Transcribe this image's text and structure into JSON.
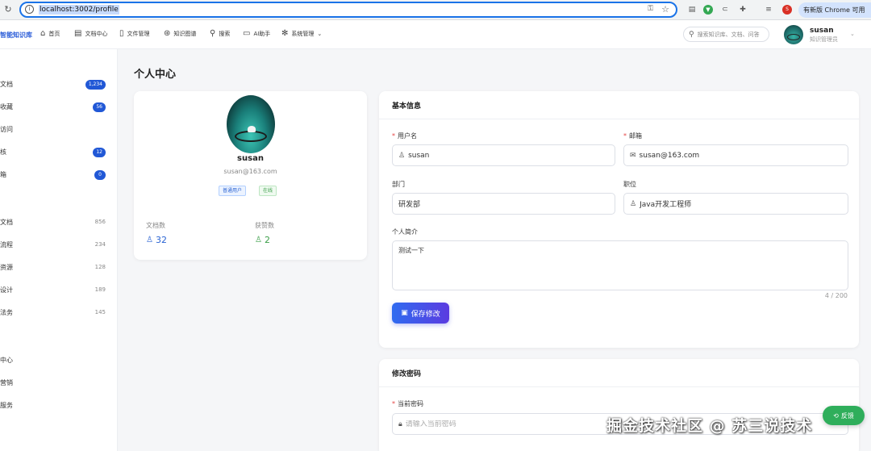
{
  "browser": {
    "url": "localhost:3002/profile",
    "update_label": "有新版 Chrome 可用"
  },
  "header": {
    "brand": "智能知识库",
    "nav": [
      {
        "label": "首页",
        "icon": "home-icon"
      },
      {
        "label": "文档中心",
        "icon": "document-icon"
      },
      {
        "label": "文件管理",
        "icon": "file-icon"
      },
      {
        "label": "知识图谱",
        "icon": "graph-icon"
      },
      {
        "label": "搜索",
        "icon": "search-icon"
      },
      {
        "label": "AI助手",
        "icon": "chat-icon"
      },
      {
        "label": "系统管理",
        "icon": "settings-icon"
      }
    ],
    "search_placeholder": "搜索知识库、文档、问答",
    "user": {
      "name": "susan",
      "role": "知识管理员"
    }
  },
  "sidebar": {
    "items": [
      {
        "label": "文档",
        "badge": "1,234"
      },
      {
        "label": "收藏",
        "badge": "56"
      },
      {
        "label": "访问",
        "badge": ""
      },
      {
        "label": "核",
        "badge": "12"
      },
      {
        "label": "箱",
        "badge": "0"
      }
    ],
    "categories": [
      {
        "label": "文档",
        "count": "856"
      },
      {
        "label": "流程",
        "count": "234"
      },
      {
        "label": "资源",
        "count": "128"
      },
      {
        "label": "设计",
        "count": "189"
      },
      {
        "label": "法务",
        "count": "145"
      }
    ],
    "extra": [
      {
        "label": "中心"
      },
      {
        "label": "营销"
      },
      {
        "label": "服务"
      }
    ]
  },
  "page": {
    "title": "个人中心"
  },
  "profile": {
    "name": "susan",
    "email": "susan@163.com",
    "tags": [
      "普通用户",
      "在线"
    ],
    "stats": [
      {
        "label": "文档数",
        "value": "32"
      },
      {
        "label": "获赞数",
        "value": "2"
      }
    ]
  },
  "basic_info": {
    "title": "基本信息",
    "username": {
      "label": "用户名",
      "value": "susan"
    },
    "email": {
      "label": "邮箱",
      "value": "susan@163.com"
    },
    "department": {
      "label": "部门",
      "value": "研发部"
    },
    "position": {
      "label": "职位",
      "value": "Java开发工程师"
    },
    "bio": {
      "label": "个人简介",
      "value": "测试一下",
      "count": "4 / 200"
    },
    "save_label": "保存修改"
  },
  "password": {
    "title": "修改密码",
    "current": {
      "label": "当前密码",
      "placeholder": "请输入当前密码"
    }
  },
  "fab_label": "反馈",
  "watermark": "掘金技术社区 @ 苏三说技术"
}
